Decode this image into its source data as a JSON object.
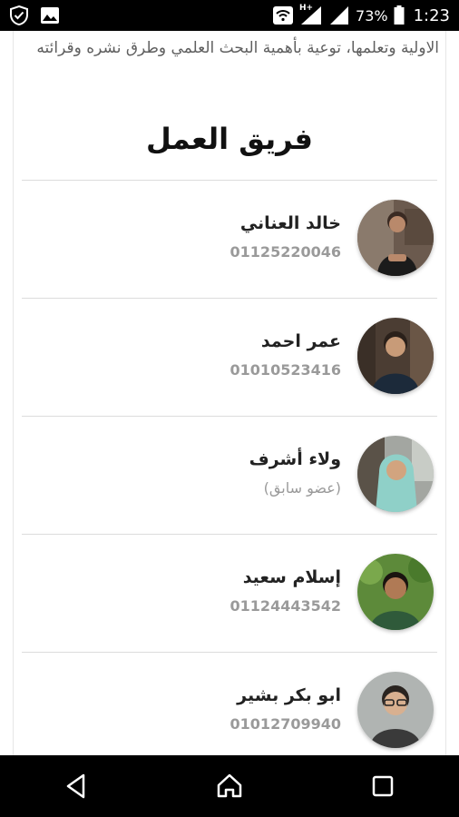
{
  "status_bar": {
    "icons_left": [
      "shield-check-icon",
      "image-icon"
    ],
    "icons_right": [
      "wifi-icon",
      "signal-h-icon",
      "signal-icon",
      "battery-icon"
    ],
    "network_type": "H+",
    "battery": "73%",
    "time": "1:23"
  },
  "intro_text": "الاولية وتعلمها، توعية بأهمية البحث العلمي وطرق نشره وقرائته",
  "section_title": "فريق العمل",
  "members": [
    {
      "name": "خالد العناني",
      "subtitle": "01125220046"
    },
    {
      "name": "عمر احمد",
      "subtitle": "01010523416"
    },
    {
      "name": "ولاء أشرف",
      "subtitle": "(عضو سابق)"
    },
    {
      "name": "إسلام سعيد",
      "subtitle": "01124443542"
    },
    {
      "name": "ابو بكر بشير",
      "subtitle": "01012709940"
    }
  ],
  "nav": [
    "back-icon",
    "home-icon",
    "recents-icon"
  ],
  "colors": {
    "divider": "#dcdcdc",
    "muted_text": "#9a9a9a",
    "title_text": "#111111"
  }
}
